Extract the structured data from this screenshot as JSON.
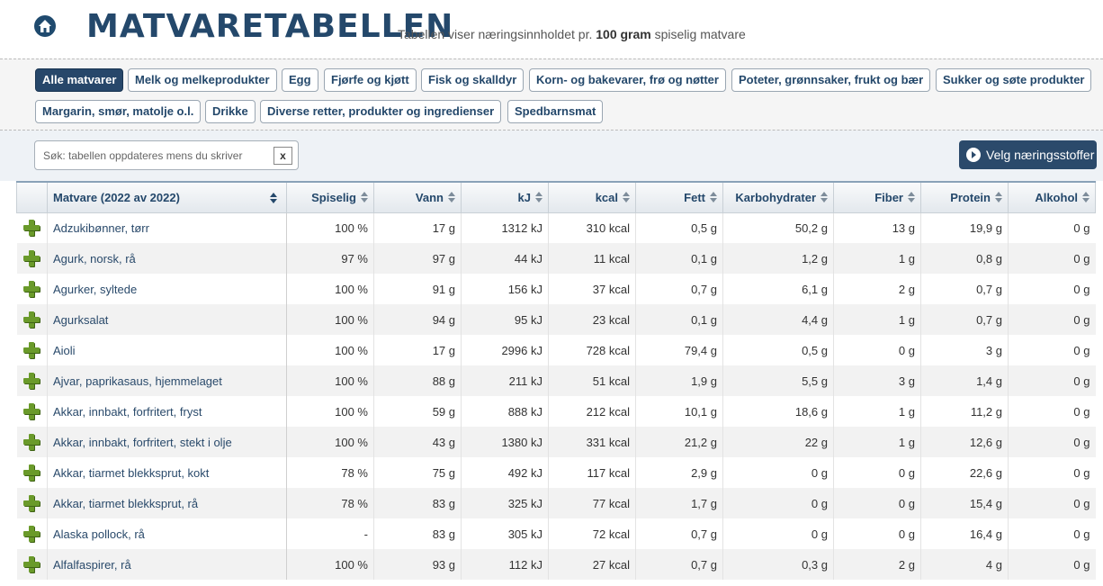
{
  "header": {
    "title": "MATVARETABELLEN",
    "tagline_pre": "Tabellen viser næringsinnholdet pr. ",
    "tagline_bold": "100 gram",
    "tagline_post": " spiselig matvare"
  },
  "categories": [
    {
      "label": "Alle matvarer",
      "active": true
    },
    {
      "label": "Melk og melkeprodukter"
    },
    {
      "label": "Egg"
    },
    {
      "label": "Fjørfe og kjøtt"
    },
    {
      "label": "Fisk og skalldyr"
    },
    {
      "label": "Korn- og bakevarer, frø og nøtter"
    },
    {
      "label": "Poteter, grønnsaker, frukt og bær"
    },
    {
      "label": "Sukker og søte produkter"
    },
    {
      "label": "Margarin, smør, matolje o.l."
    },
    {
      "label": "Drikke"
    },
    {
      "label": "Diverse retter, produkter og ingredienser"
    },
    {
      "label": "Spedbarnsmat"
    }
  ],
  "search": {
    "placeholder": "Søk: tabellen oppdateres mens du skriver",
    "clear_label": "x"
  },
  "nutrients_button": "Velg næringsstoffer",
  "table": {
    "columns": [
      "Matvare (2022 av 2022)",
      "Spiselig",
      "Vann",
      "kJ",
      "kcal",
      "Fett",
      "Karbohydrater",
      "Fiber",
      "Protein",
      "Alkohol"
    ],
    "rows": [
      [
        "Adzukibønner, tørr",
        "100 %",
        "17 g",
        "1312 kJ",
        "310 kcal",
        "0,5 g",
        "50,2 g",
        "13 g",
        "19,9 g",
        "0 g"
      ],
      [
        "Agurk, norsk, rå",
        "97 %",
        "97 g",
        "44 kJ",
        "11 kcal",
        "0,1 g",
        "1,2 g",
        "1 g",
        "0,8 g",
        "0 g"
      ],
      [
        "Agurker, syltede",
        "100 %",
        "91 g",
        "156 kJ",
        "37 kcal",
        "0,7 g",
        "6,1 g",
        "2 g",
        "0,7 g",
        "0 g"
      ],
      [
        "Agurksalat",
        "100 %",
        "94 g",
        "95 kJ",
        "23 kcal",
        "0,1 g",
        "4,4 g",
        "1 g",
        "0,7 g",
        "0 g"
      ],
      [
        "Aioli",
        "100 %",
        "17 g",
        "2996 kJ",
        "728 kcal",
        "79,4 g",
        "0,5 g",
        "0 g",
        "3 g",
        "0 g"
      ],
      [
        "Ajvar, paprikasaus, hjemmelaget",
        "100 %",
        "88 g",
        "211 kJ",
        "51 kcal",
        "1,9 g",
        "5,5 g",
        "3 g",
        "1,4 g",
        "0 g"
      ],
      [
        "Akkar, innbakt, forfritert, fryst",
        "100 %",
        "59 g",
        "888 kJ",
        "212 kcal",
        "10,1 g",
        "18,6 g",
        "1 g",
        "11,2 g",
        "0 g"
      ],
      [
        "Akkar, innbakt, forfritert, stekt i olje",
        "100 %",
        "43 g",
        "1380 kJ",
        "331 kcal",
        "21,2 g",
        "22 g",
        "1 g",
        "12,6 g",
        "0 g"
      ],
      [
        "Akkar, tiarmet blekksprut, kokt",
        "78 %",
        "75 g",
        "492 kJ",
        "117 kcal",
        "2,9 g",
        "0 g",
        "0 g",
        "22,6 g",
        "0 g"
      ],
      [
        "Akkar, tiarmet blekksprut, rå",
        "78 %",
        "83 g",
        "325 kJ",
        "77 kcal",
        "1,7 g",
        "0 g",
        "0 g",
        "15,4 g",
        "0 g"
      ],
      [
        "Alaska pollock, rå",
        "-",
        "83 g",
        "305 kJ",
        "72 kcal",
        "0,7 g",
        "0 g",
        "0 g",
        "16,4 g",
        "0 g"
      ],
      [
        "Alfalfaspirer, rå",
        "100 %",
        "93 g",
        "112 kJ",
        "27 kcal",
        "0,7 g",
        "0,3 g",
        "2 g",
        "4 g",
        "0 g"
      ]
    ]
  }
}
